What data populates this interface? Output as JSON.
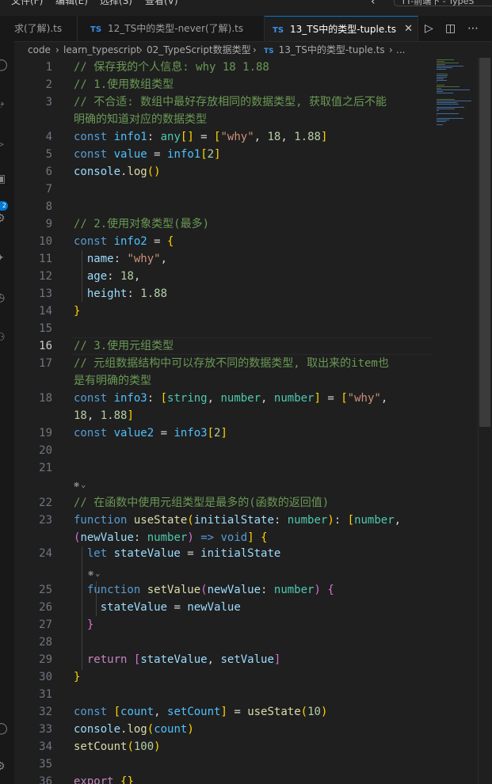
{
  "menu": [
    "文件(F)",
    "编辑(E)",
    "选择(S)",
    "查看(V)"
  ],
  "command_center": "TT-前端下 - TypeS",
  "tabs": [
    {
      "label": "求(了解).ts",
      "active": false
    },
    {
      "label": "12_TS中的类型-never(了解).ts",
      "active": false
    },
    {
      "label": "13_TS中的类型-tuple.ts",
      "active": true
    }
  ],
  "tab_icon_text": "TS",
  "breadcrumbs": [
    "code",
    "learn_typescript",
    "02_TypeScript数据类型",
    "13_TS中的类型-tuple.ts",
    "..."
  ],
  "activity_badge": "2",
  "code_lines": [
    {
      "n": "1",
      "tokens": [
        [
          "c-com",
          "// 保存我的个人信息: why 18 1.88"
        ]
      ]
    },
    {
      "n": "2",
      "tokens": [
        [
          "c-com",
          "// 1.使用数组类型"
        ]
      ]
    },
    {
      "n": "3",
      "tokens": [
        [
          "c-com",
          "// 不合适: 数组中最好存放相同的数据类型, 获取值之后不能"
        ]
      ]
    },
    {
      "n": "",
      "tokens": [
        [
          "c-com",
          "明确的知道对应的数据类型"
        ]
      ]
    },
    {
      "n": "4",
      "tokens": [
        [
          "c-kw",
          "const "
        ],
        [
          "c-const",
          "info1"
        ],
        [
          "c-op",
          ": "
        ],
        [
          "c-type",
          "any"
        ],
        [
          "c-p1",
          "[]"
        ],
        [
          "c-op",
          " = "
        ],
        [
          "c-p1",
          "["
        ],
        [
          "c-str",
          "\"why\""
        ],
        [
          "c-op",
          ", "
        ],
        [
          "c-num",
          "18"
        ],
        [
          "c-op",
          ", "
        ],
        [
          "c-num",
          "1.88"
        ],
        [
          "c-p1",
          "]"
        ]
      ]
    },
    {
      "n": "5",
      "tokens": [
        [
          "c-kw",
          "const "
        ],
        [
          "c-const",
          "value"
        ],
        [
          "c-op",
          " = "
        ],
        [
          "c-const",
          "info1"
        ],
        [
          "c-p1",
          "["
        ],
        [
          "c-num",
          "2"
        ],
        [
          "c-p1",
          "]"
        ]
      ]
    },
    {
      "n": "6",
      "tokens": [
        [
          "c-var",
          "console"
        ],
        [
          "c-op",
          "."
        ],
        [
          "c-fn",
          "log"
        ],
        [
          "c-p1",
          "()"
        ]
      ]
    },
    {
      "n": "7",
      "tokens": []
    },
    {
      "n": "8",
      "tokens": []
    },
    {
      "n": "9",
      "tokens": [
        [
          "c-com",
          "// 2.使用对象类型(最多)"
        ]
      ]
    },
    {
      "n": "10",
      "tokens": [
        [
          "c-kw",
          "const "
        ],
        [
          "c-const",
          "info2"
        ],
        [
          "c-op",
          " = "
        ],
        [
          "c-p1",
          "{"
        ]
      ]
    },
    {
      "n": "11",
      "tokens": [
        [
          "c-op",
          "  "
        ],
        [
          "c-var",
          "name"
        ],
        [
          "c-op",
          ": "
        ],
        [
          "c-str",
          "\"why\""
        ],
        [
          "c-op",
          ","
        ]
      ]
    },
    {
      "n": "12",
      "tokens": [
        [
          "c-op",
          "  "
        ],
        [
          "c-var",
          "age"
        ],
        [
          "c-op",
          ": "
        ],
        [
          "c-num",
          "18"
        ],
        [
          "c-op",
          ","
        ]
      ]
    },
    {
      "n": "13",
      "tokens": [
        [
          "c-op",
          "  "
        ],
        [
          "c-var",
          "height"
        ],
        [
          "c-op",
          ": "
        ],
        [
          "c-num",
          "1.88"
        ]
      ]
    },
    {
      "n": "14",
      "tokens": [
        [
          "c-p1",
          "}"
        ]
      ]
    },
    {
      "n": "15",
      "tokens": []
    },
    {
      "n": "16",
      "tokens": [
        [
          "c-com",
          "// 3.使用元组类型"
        ]
      ],
      "current": true
    },
    {
      "n": "17",
      "tokens": [
        [
          "c-com",
          "// 元组数据结构中可以存放不同的数据类型, 取出来的item也"
        ]
      ]
    },
    {
      "n": "",
      "tokens": [
        [
          "c-com",
          "是有明确的类型"
        ]
      ]
    },
    {
      "n": "18",
      "tokens": [
        [
          "c-kw",
          "const "
        ],
        [
          "c-const",
          "info3"
        ],
        [
          "c-op",
          ": "
        ],
        [
          "c-p1",
          "["
        ],
        [
          "c-type",
          "string"
        ],
        [
          "c-op",
          ", "
        ],
        [
          "c-type",
          "number"
        ],
        [
          "c-op",
          ", "
        ],
        [
          "c-type",
          "number"
        ],
        [
          "c-p1",
          "]"
        ],
        [
          "c-op",
          " = "
        ],
        [
          "c-p1",
          "["
        ],
        [
          "c-str",
          "\"why\""
        ],
        [
          "c-op",
          ","
        ]
      ]
    },
    {
      "n": "",
      "tokens": [
        [
          "c-num",
          "18"
        ],
        [
          "c-op",
          ", "
        ],
        [
          "c-num",
          "1.88"
        ],
        [
          "c-p1",
          "]"
        ]
      ]
    },
    {
      "n": "19",
      "tokens": [
        [
          "c-kw",
          "const "
        ],
        [
          "c-const",
          "value2"
        ],
        [
          "c-op",
          " = "
        ],
        [
          "c-const",
          "info3"
        ],
        [
          "c-p1",
          "["
        ],
        [
          "c-num",
          "2"
        ],
        [
          "c-p1",
          "]"
        ]
      ]
    },
    {
      "n": "20",
      "tokens": []
    },
    {
      "n": "21",
      "tokens": []
    },
    {
      "n": "",
      "tokens": [],
      "codeicon": "indent0"
    },
    {
      "n": "22",
      "tokens": [
        [
          "c-com",
          "// 在函数中使用元组类型是最多的(函数的返回值)"
        ]
      ]
    },
    {
      "n": "23",
      "tokens": [
        [
          "c-kw",
          "function "
        ],
        [
          "c-fn",
          "useState"
        ],
        [
          "c-p1",
          "("
        ],
        [
          "c-var",
          "initialState"
        ],
        [
          "c-op",
          ": "
        ],
        [
          "c-type",
          "number"
        ],
        [
          "c-p1",
          ")"
        ],
        [
          "c-op",
          ": "
        ],
        [
          "c-p1",
          "["
        ],
        [
          "c-type",
          "number"
        ],
        [
          "c-op",
          ","
        ]
      ]
    },
    {
      "n": "",
      "tokens": [
        [
          "c-p2",
          "("
        ],
        [
          "c-var",
          "newValue"
        ],
        [
          "c-op",
          ": "
        ],
        [
          "c-type",
          "number"
        ],
        [
          "c-p2",
          ")"
        ],
        [
          "c-op",
          " "
        ],
        [
          "c-kw",
          "=>"
        ],
        [
          "c-op",
          " "
        ],
        [
          "c-kw",
          "void"
        ],
        [
          "c-p1",
          "]"
        ],
        [
          "c-op",
          " "
        ],
        [
          "c-p1",
          "{"
        ]
      ]
    },
    {
      "n": "24",
      "tokens": [
        [
          "c-op",
          "  "
        ],
        [
          "c-kw",
          "let "
        ],
        [
          "c-var",
          "stateValue"
        ],
        [
          "c-op",
          " = "
        ],
        [
          "c-var",
          "initialState"
        ]
      ]
    },
    {
      "n": "",
      "tokens": [],
      "codeicon": "indent1"
    },
    {
      "n": "25",
      "tokens": [
        [
          "c-op",
          "  "
        ],
        [
          "c-kw",
          "function "
        ],
        [
          "c-fn",
          "setValue"
        ],
        [
          "c-p2",
          "("
        ],
        [
          "c-var",
          "newValue"
        ],
        [
          "c-op",
          ": "
        ],
        [
          "c-type",
          "number"
        ],
        [
          "c-p2",
          ")"
        ],
        [
          "c-op",
          " "
        ],
        [
          "c-p2",
          "{"
        ]
      ]
    },
    {
      "n": "26",
      "tokens": [
        [
          "c-op",
          "    "
        ],
        [
          "c-var",
          "stateValue"
        ],
        [
          "c-op",
          " = "
        ],
        [
          "c-var",
          "newValue"
        ]
      ]
    },
    {
      "n": "27",
      "tokens": [
        [
          "c-op",
          "  "
        ],
        [
          "c-p2",
          "}"
        ]
      ]
    },
    {
      "n": "28",
      "tokens": []
    },
    {
      "n": "29",
      "tokens": [
        [
          "c-op",
          "  "
        ],
        [
          "c-kw2",
          "return "
        ],
        [
          "c-p2",
          "["
        ],
        [
          "c-var",
          "stateValue"
        ],
        [
          "c-op",
          ", "
        ],
        [
          "c-var",
          "setValue"
        ],
        [
          "c-p2",
          "]"
        ]
      ]
    },
    {
      "n": "30",
      "tokens": [
        [
          "c-p1",
          "}"
        ]
      ]
    },
    {
      "n": "31",
      "tokens": []
    },
    {
      "n": "32",
      "tokens": [
        [
          "c-kw",
          "const "
        ],
        [
          "c-p1",
          "["
        ],
        [
          "c-const",
          "count"
        ],
        [
          "c-op",
          ", "
        ],
        [
          "c-const",
          "setCount"
        ],
        [
          "c-p1",
          "]"
        ],
        [
          "c-op",
          " = "
        ],
        [
          "c-fn",
          "useState"
        ],
        [
          "c-p1",
          "("
        ],
        [
          "c-num",
          "10"
        ],
        [
          "c-p1",
          ")"
        ]
      ]
    },
    {
      "n": "33",
      "tokens": [
        [
          "c-var",
          "console"
        ],
        [
          "c-op",
          "."
        ],
        [
          "c-fn",
          "log"
        ],
        [
          "c-p1",
          "("
        ],
        [
          "c-const",
          "count"
        ],
        [
          "c-p1",
          ")"
        ]
      ]
    },
    {
      "n": "34",
      "tokens": [
        [
          "c-fn",
          "setCount"
        ],
        [
          "c-p1",
          "("
        ],
        [
          "c-num",
          "100"
        ],
        [
          "c-p1",
          ")"
        ]
      ]
    },
    {
      "n": "35",
      "tokens": []
    },
    {
      "n": "36",
      "tokens": [
        [
          "c-kw2",
          "export "
        ],
        [
          "c-p1",
          "{}"
        ]
      ]
    }
  ]
}
